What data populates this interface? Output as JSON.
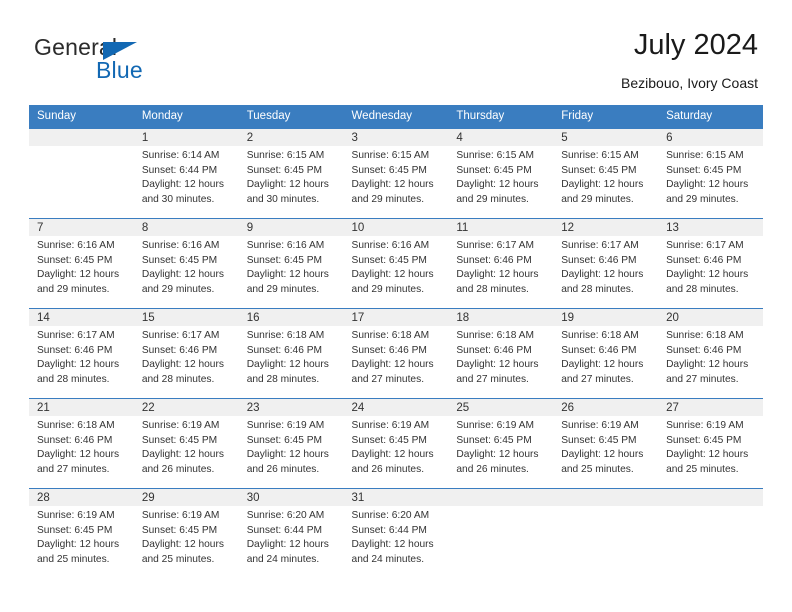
{
  "brand": {
    "name_part1": "General",
    "name_part2": "Blue",
    "flag_icon": "blue-triangle-flag",
    "color_primary": "#1268b3",
    "color_text": "#2b2b2b"
  },
  "header": {
    "title": "July 2024",
    "subtitle": "Bezibouo, Ivory Coast"
  },
  "calendar": {
    "header_bg": "#3a7dc0",
    "daynum_band_bg": "#f0f0f0",
    "weekdays": [
      "Sunday",
      "Monday",
      "Tuesday",
      "Wednesday",
      "Thursday",
      "Friday",
      "Saturday"
    ],
    "weeks": [
      [
        {
          "day": "",
          "empty": true,
          "sunrise": "",
          "sunset": "",
          "daylight_line1": "",
          "daylight_line2": ""
        },
        {
          "day": "1",
          "sunrise": "Sunrise: 6:14 AM",
          "sunset": "Sunset: 6:44 PM",
          "daylight_line1": "Daylight: 12 hours",
          "daylight_line2": "and 30 minutes."
        },
        {
          "day": "2",
          "sunrise": "Sunrise: 6:15 AM",
          "sunset": "Sunset: 6:45 PM",
          "daylight_line1": "Daylight: 12 hours",
          "daylight_line2": "and 30 minutes."
        },
        {
          "day": "3",
          "sunrise": "Sunrise: 6:15 AM",
          "sunset": "Sunset: 6:45 PM",
          "daylight_line1": "Daylight: 12 hours",
          "daylight_line2": "and 29 minutes."
        },
        {
          "day": "4",
          "sunrise": "Sunrise: 6:15 AM",
          "sunset": "Sunset: 6:45 PM",
          "daylight_line1": "Daylight: 12 hours",
          "daylight_line2": "and 29 minutes."
        },
        {
          "day": "5",
          "sunrise": "Sunrise: 6:15 AM",
          "sunset": "Sunset: 6:45 PM",
          "daylight_line1": "Daylight: 12 hours",
          "daylight_line2": "and 29 minutes."
        },
        {
          "day": "6",
          "sunrise": "Sunrise: 6:15 AM",
          "sunset": "Sunset: 6:45 PM",
          "daylight_line1": "Daylight: 12 hours",
          "daylight_line2": "and 29 minutes."
        }
      ],
      [
        {
          "day": "7",
          "sunrise": "Sunrise: 6:16 AM",
          "sunset": "Sunset: 6:45 PM",
          "daylight_line1": "Daylight: 12 hours",
          "daylight_line2": "and 29 minutes."
        },
        {
          "day": "8",
          "sunrise": "Sunrise: 6:16 AM",
          "sunset": "Sunset: 6:45 PM",
          "daylight_line1": "Daylight: 12 hours",
          "daylight_line2": "and 29 minutes."
        },
        {
          "day": "9",
          "sunrise": "Sunrise: 6:16 AM",
          "sunset": "Sunset: 6:45 PM",
          "daylight_line1": "Daylight: 12 hours",
          "daylight_line2": "and 29 minutes."
        },
        {
          "day": "10",
          "sunrise": "Sunrise: 6:16 AM",
          "sunset": "Sunset: 6:45 PM",
          "daylight_line1": "Daylight: 12 hours",
          "daylight_line2": "and 29 minutes."
        },
        {
          "day": "11",
          "sunrise": "Sunrise: 6:17 AM",
          "sunset": "Sunset: 6:46 PM",
          "daylight_line1": "Daylight: 12 hours",
          "daylight_line2": "and 28 minutes."
        },
        {
          "day": "12",
          "sunrise": "Sunrise: 6:17 AM",
          "sunset": "Sunset: 6:46 PM",
          "daylight_line1": "Daylight: 12 hours",
          "daylight_line2": "and 28 minutes."
        },
        {
          "day": "13",
          "sunrise": "Sunrise: 6:17 AM",
          "sunset": "Sunset: 6:46 PM",
          "daylight_line1": "Daylight: 12 hours",
          "daylight_line2": "and 28 minutes."
        }
      ],
      [
        {
          "day": "14",
          "sunrise": "Sunrise: 6:17 AM",
          "sunset": "Sunset: 6:46 PM",
          "daylight_line1": "Daylight: 12 hours",
          "daylight_line2": "and 28 minutes."
        },
        {
          "day": "15",
          "sunrise": "Sunrise: 6:17 AM",
          "sunset": "Sunset: 6:46 PM",
          "daylight_line1": "Daylight: 12 hours",
          "daylight_line2": "and 28 minutes."
        },
        {
          "day": "16",
          "sunrise": "Sunrise: 6:18 AM",
          "sunset": "Sunset: 6:46 PM",
          "daylight_line1": "Daylight: 12 hours",
          "daylight_line2": "and 28 minutes."
        },
        {
          "day": "17",
          "sunrise": "Sunrise: 6:18 AM",
          "sunset": "Sunset: 6:46 PM",
          "daylight_line1": "Daylight: 12 hours",
          "daylight_line2": "and 27 minutes."
        },
        {
          "day": "18",
          "sunrise": "Sunrise: 6:18 AM",
          "sunset": "Sunset: 6:46 PM",
          "daylight_line1": "Daylight: 12 hours",
          "daylight_line2": "and 27 minutes."
        },
        {
          "day": "19",
          "sunrise": "Sunrise: 6:18 AM",
          "sunset": "Sunset: 6:46 PM",
          "daylight_line1": "Daylight: 12 hours",
          "daylight_line2": "and 27 minutes."
        },
        {
          "day": "20",
          "sunrise": "Sunrise: 6:18 AM",
          "sunset": "Sunset: 6:46 PM",
          "daylight_line1": "Daylight: 12 hours",
          "daylight_line2": "and 27 minutes."
        }
      ],
      [
        {
          "day": "21",
          "sunrise": "Sunrise: 6:18 AM",
          "sunset": "Sunset: 6:46 PM",
          "daylight_line1": "Daylight: 12 hours",
          "daylight_line2": "and 27 minutes."
        },
        {
          "day": "22",
          "sunrise": "Sunrise: 6:19 AM",
          "sunset": "Sunset: 6:45 PM",
          "daylight_line1": "Daylight: 12 hours",
          "daylight_line2": "and 26 minutes."
        },
        {
          "day": "23",
          "sunrise": "Sunrise: 6:19 AM",
          "sunset": "Sunset: 6:45 PM",
          "daylight_line1": "Daylight: 12 hours",
          "daylight_line2": "and 26 minutes."
        },
        {
          "day": "24",
          "sunrise": "Sunrise: 6:19 AM",
          "sunset": "Sunset: 6:45 PM",
          "daylight_line1": "Daylight: 12 hours",
          "daylight_line2": "and 26 minutes."
        },
        {
          "day": "25",
          "sunrise": "Sunrise: 6:19 AM",
          "sunset": "Sunset: 6:45 PM",
          "daylight_line1": "Daylight: 12 hours",
          "daylight_line2": "and 26 minutes."
        },
        {
          "day": "26",
          "sunrise": "Sunrise: 6:19 AM",
          "sunset": "Sunset: 6:45 PM",
          "daylight_line1": "Daylight: 12 hours",
          "daylight_line2": "and 25 minutes."
        },
        {
          "day": "27",
          "sunrise": "Sunrise: 6:19 AM",
          "sunset": "Sunset: 6:45 PM",
          "daylight_line1": "Daylight: 12 hours",
          "daylight_line2": "and 25 minutes."
        }
      ],
      [
        {
          "day": "28",
          "sunrise": "Sunrise: 6:19 AM",
          "sunset": "Sunset: 6:45 PM",
          "daylight_line1": "Daylight: 12 hours",
          "daylight_line2": "and 25 minutes."
        },
        {
          "day": "29",
          "sunrise": "Sunrise: 6:19 AM",
          "sunset": "Sunset: 6:45 PM",
          "daylight_line1": "Daylight: 12 hours",
          "daylight_line2": "and 25 minutes."
        },
        {
          "day": "30",
          "sunrise": "Sunrise: 6:20 AM",
          "sunset": "Sunset: 6:44 PM",
          "daylight_line1": "Daylight: 12 hours",
          "daylight_line2": "and 24 minutes."
        },
        {
          "day": "31",
          "sunrise": "Sunrise: 6:20 AM",
          "sunset": "Sunset: 6:44 PM",
          "daylight_line1": "Daylight: 12 hours",
          "daylight_line2": "and 24 minutes."
        },
        {
          "day": "",
          "empty": true,
          "sunrise": "",
          "sunset": "",
          "daylight_line1": "",
          "daylight_line2": ""
        },
        {
          "day": "",
          "empty": true,
          "sunrise": "",
          "sunset": "",
          "daylight_line1": "",
          "daylight_line2": ""
        },
        {
          "day": "",
          "empty": true,
          "sunrise": "",
          "sunset": "",
          "daylight_line1": "",
          "daylight_line2": ""
        }
      ]
    ]
  }
}
